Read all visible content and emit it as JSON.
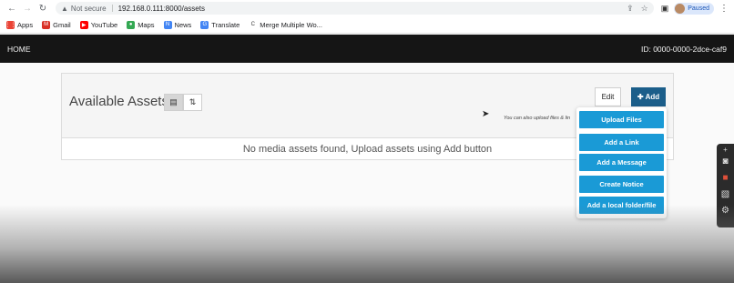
{
  "browser": {
    "not_secure": "Not secure",
    "url": "192.168.0.111:8000/assets",
    "profile_label": "Paused",
    "bookmarks": [
      {
        "label": "Apps",
        "icon": "apps-grid-icon",
        "color": "#ea4335"
      },
      {
        "label": "Gmail",
        "icon": "gmail-icon",
        "color": "#d93025"
      },
      {
        "label": "YouTube",
        "icon": "youtube-icon",
        "color": "#ff0000"
      },
      {
        "label": "Maps",
        "icon": "maps-pin-icon",
        "color": "#34a853"
      },
      {
        "label": "News",
        "icon": "news-icon",
        "color": "#4285f4"
      },
      {
        "label": "Translate",
        "icon": "translate-icon",
        "color": "#4285f4"
      },
      {
        "label": "Merge Multiple Wo...",
        "icon": "merge-icon",
        "color": "#333333"
      }
    ]
  },
  "appnav": {
    "home": "HOME",
    "device_id": "ID: 0000-0000-2dce-caf9"
  },
  "panel": {
    "title": "Available Assets",
    "edit_label": "Edit",
    "add_label": "Add",
    "hint": "You can also upload files & lin",
    "empty_message": "No media assets found, Upload assets using Add button"
  },
  "add_menu": {
    "items": [
      "Upload Files",
      "Add a Link",
      "Add a Message",
      "Create Notice",
      "Add a local folder/file"
    ]
  },
  "colors": {
    "navbar": "#151515",
    "add_button": "#1b5e8a",
    "menu_item": "#1a9ad6"
  }
}
